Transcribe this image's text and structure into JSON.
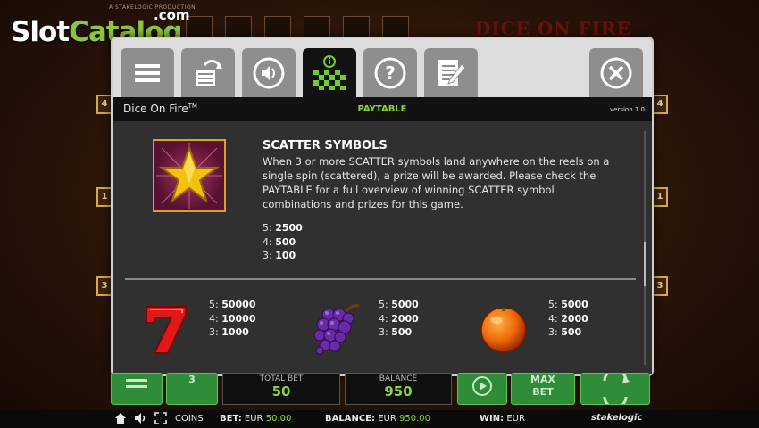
{
  "brand": {
    "logo_main": "Slot",
    "logo_highlight": "Catalog",
    "logo_domain": ".com"
  },
  "background": {
    "game_title": "DICE ON FIRE",
    "producer_label": "A STAKELOGIC PRODUCTION",
    "side_numbers": [
      "4",
      "4",
      "1",
      "1",
      "3",
      "3"
    ]
  },
  "dialog": {
    "tabs": [
      "menu-icon",
      "autoplay-icon",
      "sound-icon",
      "paytable-icon",
      "help-icon",
      "rules-icon"
    ],
    "active_tab": "paytable-icon",
    "close_icon": "close-icon",
    "title": "Dice On Fire",
    "trademark": "TM",
    "tab_label": "PAYTABLE",
    "version": "version 1.0",
    "scatter": {
      "heading": "SCATTER SYMBOLS",
      "description": "When 3 or more SCATTER symbols land anywhere on the reels on a single spin (scattered), a prize will be awarded. Please check the PAYTABLE for a full overview of winning SCATTER symbol combinations and prizes for this game.",
      "payouts": [
        {
          "count": "5:",
          "value": "2500"
        },
        {
          "count": "4:",
          "value": "500"
        },
        {
          "count": "3:",
          "value": "100"
        }
      ]
    },
    "symbols": [
      {
        "name": "seven",
        "payouts": [
          {
            "count": "5:",
            "value": "50000"
          },
          {
            "count": "4:",
            "value": "10000"
          },
          {
            "count": "3:",
            "value": "1000"
          }
        ]
      },
      {
        "name": "grapes",
        "payouts": [
          {
            "count": "5:",
            "value": "5000"
          },
          {
            "count": "4:",
            "value": "2000"
          },
          {
            "count": "3:",
            "value": "500"
          }
        ]
      },
      {
        "name": "orange",
        "payouts": [
          {
            "count": "5:",
            "value": "5000"
          },
          {
            "count": "4:",
            "value": "2000"
          },
          {
            "count": "3:",
            "value": "500"
          }
        ]
      }
    ]
  },
  "controls": {
    "spin_count": "3",
    "total_bet_label": "TOTAL BET",
    "total_bet_value": "50",
    "balance_label": "BALANCE",
    "balance_value": "950",
    "max_label": "MAX",
    "bet_label": "BET"
  },
  "statusbar": {
    "coins_label": "COINS",
    "bet_label": "BET:",
    "bet_currency": "EUR",
    "bet_value": "50.00",
    "balance_label": "BALANCE:",
    "balance_currency": "EUR",
    "balance_value": "950.00",
    "win_label": "WIN:",
    "win_currency": "EUR",
    "provider": "stakelogic"
  },
  "colors": {
    "accent_green": "#8cd33a",
    "brand_green": "#8cc63f",
    "toolbar_grey": "#8e8e8e",
    "panel": "#303030"
  }
}
